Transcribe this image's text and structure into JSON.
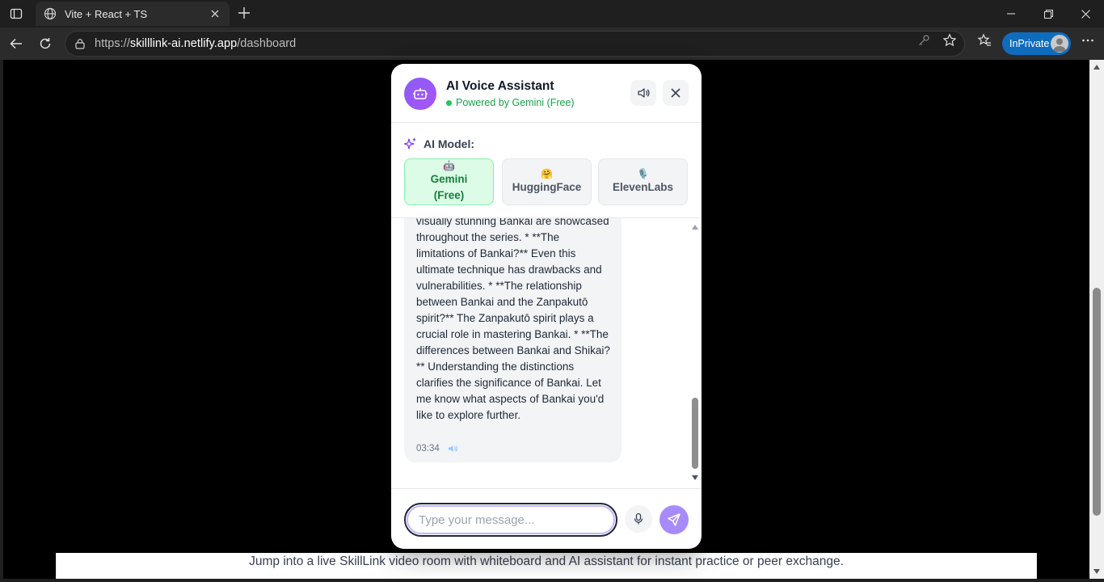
{
  "browser": {
    "tab_title": "Vite + React + TS",
    "url_prefix": "https://",
    "url_host": "skilllink-ai.netlify.app",
    "url_path": "/dashboard",
    "inprivate_label": "InPrivate"
  },
  "assistant": {
    "title": "AI Voice Assistant",
    "subtitle": "Powered by Gemini (Free)",
    "model_label": "AI Model:",
    "models": [
      {
        "emoji": "🤖",
        "name": "Gemini (Free)",
        "active": true
      },
      {
        "emoji": "🤗",
        "name": "HuggingFace",
        "active": false
      },
      {
        "emoji": "🎙️",
        "name": "ElevenLabs",
        "active": false
      }
    ],
    "message": {
      "text": "visually stunning Bankai are showcased throughout the series. * **The limitations of Bankai?** Even this ultimate technique has drawbacks and vulnerabilities. * **The relationship between Bankai and the Zanpakutō spirit?** The Zanpakutō spirit plays a crucial role in mastering Bankai. * **The differences between Bankai and Shikai?** Understanding the distinctions clarifies the significance of Bankai. Let me know what aspects of Bankai you'd like to explore further.",
      "time": "03:34"
    },
    "input_placeholder": "Type your message..."
  },
  "page": {
    "footer_text": "Jump into a live SkillLink video room with whiteboard and AI assistant for instant practice or peer exchange."
  },
  "colors": {
    "accent": "#8b5cf6",
    "active_model_bg": "#dcfce7",
    "online": "#22c55e",
    "inprivate": "#0f6cbd"
  }
}
